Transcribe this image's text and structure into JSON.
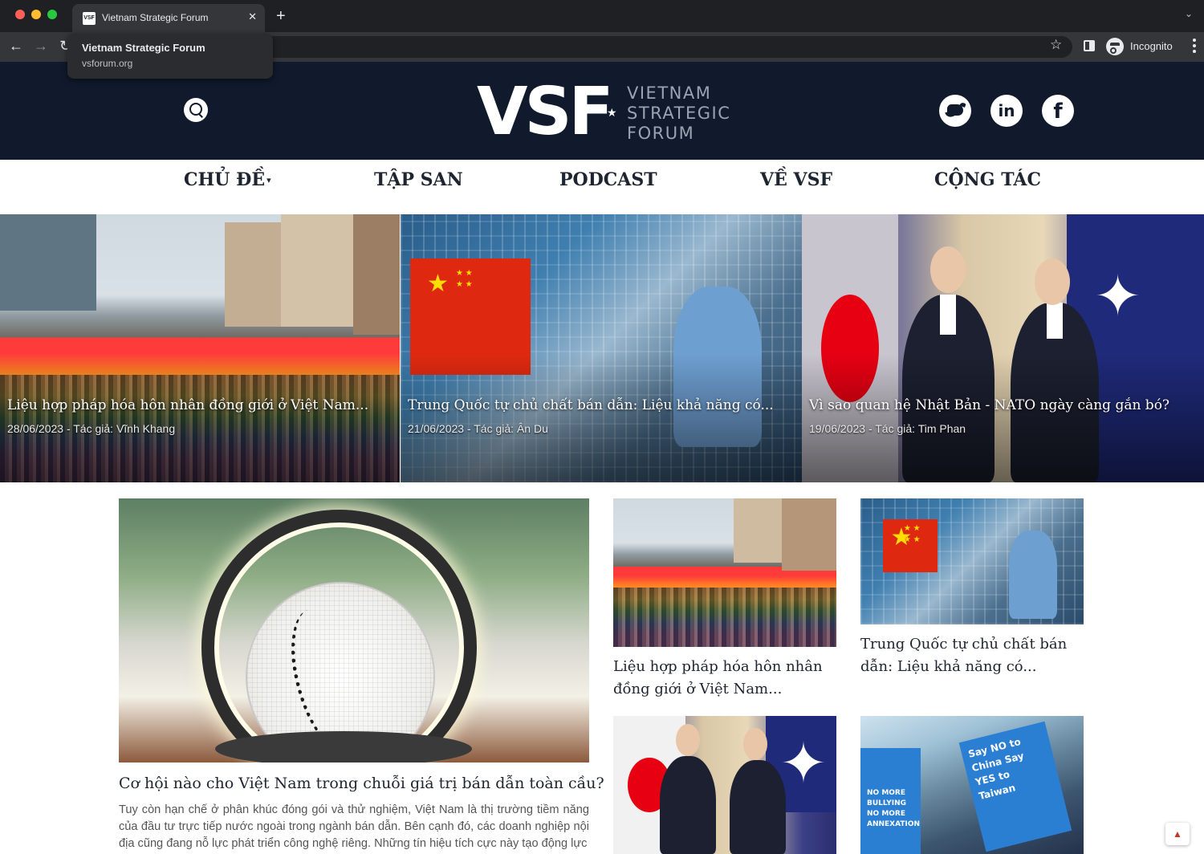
{
  "browser": {
    "tab_title": "Vietnam Strategic Forum",
    "tab_favicon_text": "VSF",
    "tooltip_title": "Vietnam Strategic Forum",
    "tooltip_url": "vsforum.org",
    "profile_label": "Incognito",
    "icons": [
      "close-icon",
      "plus-icon",
      "back-icon",
      "forward-icon",
      "reload-icon",
      "star-icon",
      "side-panel-icon",
      "incognito-icon",
      "menu-icon"
    ]
  },
  "header": {
    "logo_mark": "VSF",
    "logo_star": "★",
    "logo_sub_1": "VIETNAM",
    "logo_sub_2": "STRATEGIC",
    "logo_sub_3": "FORUM",
    "linkedin_glyph": "in",
    "facebook_glyph": "f",
    "icons": [
      "search-icon",
      "twitter-icon",
      "linkedin-icon",
      "facebook-icon"
    ],
    "bg_color": "#101a2c"
  },
  "nav": {
    "items": [
      {
        "label": "CHỦ ĐỀ",
        "caret": "▾"
      },
      {
        "label": "TẬP SAN"
      },
      {
        "label": "PODCAST"
      },
      {
        "label": "VỀ VSF"
      },
      {
        "label": "CỘNG TÁC"
      }
    ]
  },
  "hero": [
    {
      "title": "Liệu hợp pháp hóa hôn nhân đồng giới ở Việt Nam...",
      "meta": "28/06/2023 - Tác giả: Vĩnh Khang"
    },
    {
      "title": "Trung Quốc tự chủ chất bán dẫn: Liệu khả năng có...",
      "meta": "21/06/2023 - Tác giả: Ân Du"
    },
    {
      "title": "Vì sao quan hệ Nhật Bản - NATO ngày càng gắn bó?",
      "meta": "19/06/2023 - Tác giả: Tim Phan"
    }
  ],
  "feature": {
    "title": "Cơ hội nào cho Việt Nam trong chuỗi giá trị bán dẫn toàn cầu?",
    "excerpt": "Tuy còn hạn chế ở phân khúc đóng gói và thử nghiệm, Việt Nam là thị trường tiềm năng của đầu tư trực tiếp nước ngoài trong ngành bán dẫn. Bên cạnh đó, các doanh nghiệp nội địa cũng đang nỗ lực phát triển công nghệ riêng. Những tín hiệu tích cực này tạo động lực"
  },
  "cards": [
    {
      "title": "Liệu hợp pháp hóa hôn nhân đồng giới ở Việt Nam..."
    },
    {
      "title": "Trung Quốc tự chủ chất bán dẫn: Liệu khả năng có..."
    }
  ],
  "protest_signs": {
    "sign_1": "NO MORE BULLYING NO MORE ANNEXATION",
    "sign_2": "Say NO to China Say YES to Taiwan"
  },
  "back_to_top_glyph": "▲"
}
